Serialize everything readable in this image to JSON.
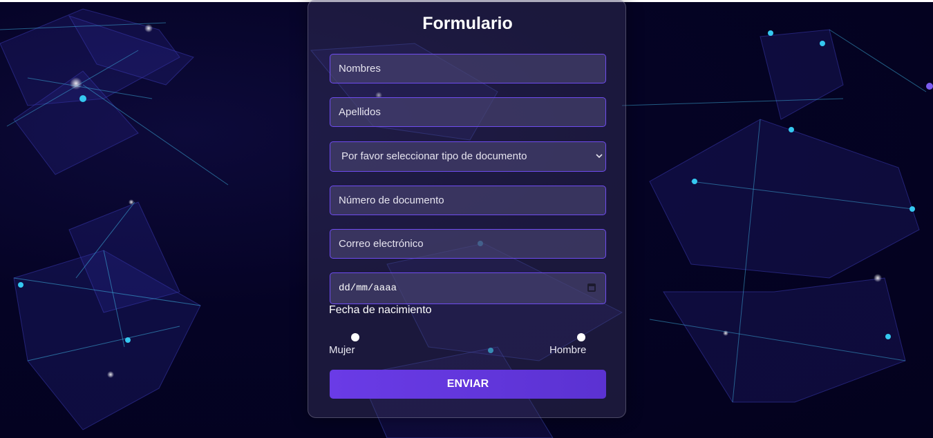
{
  "form": {
    "title": "Formulario",
    "nombres_placeholder": "Nombres",
    "apellidos_placeholder": "Apellidos",
    "tipo_documento_selected": "Por favor seleccionar tipo de documento",
    "numero_documento_placeholder": "Número de documento",
    "correo_placeholder": "Correo electrónico",
    "fecha_value": "dd/mm/aaaa",
    "fecha_label": "Fecha de nacimiento",
    "gender_options": [
      "Mujer",
      "Hombre"
    ],
    "submit_label": "ENVIAR"
  },
  "icons": {
    "select_chevron": "chevron-down-icon",
    "date_picker": "calendar-icon"
  },
  "colors": {
    "background": "#03021d",
    "accent": "#6a3be6",
    "field_border": "#6f4cf0"
  }
}
